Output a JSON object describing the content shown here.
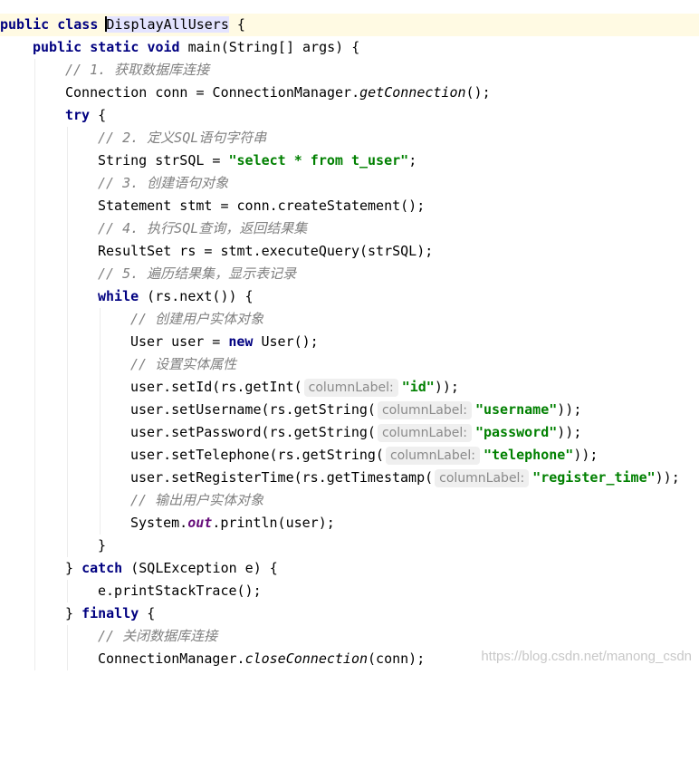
{
  "colors": {
    "background": "#ffffff",
    "keyword": "#000080",
    "string": "#008000",
    "comment": "#808080",
    "field": "#660e7a",
    "current_line": "#fffae3",
    "identifier_highlight": "#e4e4ff",
    "param_hint_bg": "#efefef"
  },
  "code": {
    "l1": {
      "kw1": "public",
      "kw2": "class",
      "name": "DisplayAllUsers",
      "rest": " {"
    },
    "l2": {
      "kw1": "public",
      "kw2": "static",
      "kw3": "void",
      "rest": " main(String[] args) {"
    },
    "l3": {
      "comment": "// 1. 获取数据库连接"
    },
    "l4": {
      "pre": "Connection conn = ConnectionManager.",
      "method": "getConnection",
      "post": "();"
    },
    "l5": {
      "kw": "try",
      "rest": " {"
    },
    "l6": {
      "comment": "// 2. 定义SQL语句字符串"
    },
    "l7": {
      "pre": "String strSQL = ",
      "str": "\"select * from t_user\"",
      "post": ";"
    },
    "l8": {
      "comment": "// 3. 创建语句对象"
    },
    "l9": {
      "text": "Statement stmt = conn.createStatement();"
    },
    "l10": {
      "comment": "// 4. 执行SQL查询，返回结果集"
    },
    "l11": {
      "text": "ResultSet rs = stmt.executeQuery(strSQL);"
    },
    "l12": {
      "comment": "// 5. 遍历结果集，显示表记录"
    },
    "l13": {
      "kw": "while",
      "rest": " (rs.next()) {"
    },
    "l14": {
      "comment": "// 创建用户实体对象"
    },
    "l15": {
      "pre": "User user = ",
      "kw": "new",
      "post": " User();"
    },
    "l16": {
      "comment": "// 设置实体属性"
    },
    "l17": {
      "pre": "user.setId(rs.getInt(",
      "hint": "columnLabel:",
      "str": "\"id\"",
      "post": "));"
    },
    "l18": {
      "pre": "user.setUsername(rs.getString(",
      "hint": "columnLabel:",
      "str": "\"username\"",
      "post": "));"
    },
    "l19": {
      "pre": "user.setPassword(rs.getString(",
      "hint": "columnLabel:",
      "str": "\"password\"",
      "post": "));"
    },
    "l20": {
      "pre": "user.setTelephone(rs.getString(",
      "hint": "columnLabel:",
      "str": "\"telephone\"",
      "post": "));"
    },
    "l21": {
      "pre": "user.setRegisterTime(rs.getTimestamp(",
      "hint": "columnLabel:",
      "str": "\"register_time\"",
      "post": "));"
    },
    "l22": {
      "comment": "// 输出用户实体对象"
    },
    "l23": {
      "pre": "System.",
      "field": "out",
      "post": ".println(user);"
    },
    "l24": {
      "text": "}"
    },
    "l25": {
      "pre": "} ",
      "kw": "catch",
      "post": " (SQLException e) {"
    },
    "l26": {
      "text": "e.printStackTrace();"
    },
    "l27": {
      "pre": "} ",
      "kw": "finally",
      "post": " {"
    },
    "l28": {
      "comment": "// 关闭数据库连接"
    },
    "l29": {
      "pre": "ConnectionManager.",
      "method": "closeConnection",
      "post": "(conn);"
    }
  },
  "watermark": "https://blog.csdn.net/manong_csdn"
}
